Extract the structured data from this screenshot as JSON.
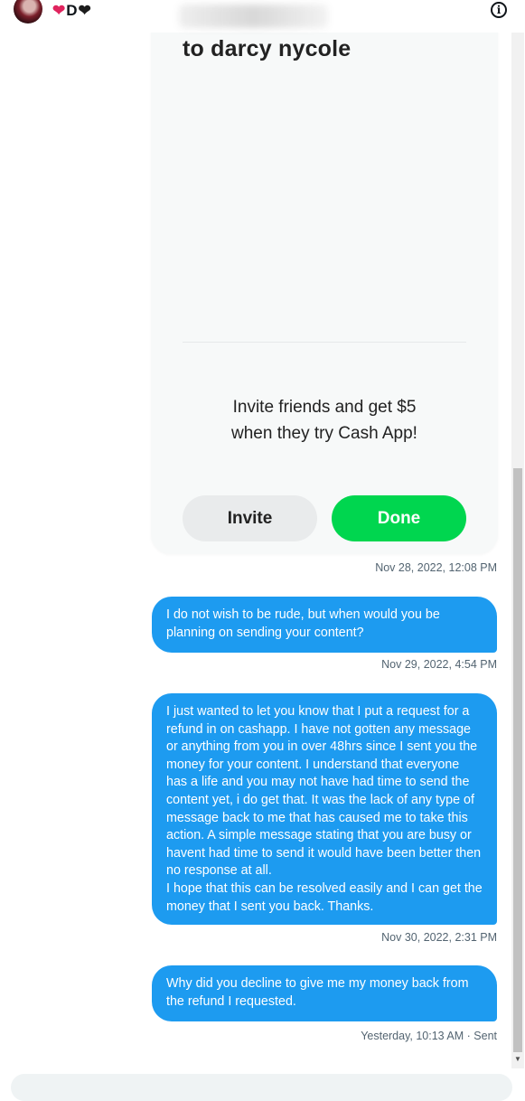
{
  "header": {
    "name_letter": "D",
    "info_icon": "info-circle-icon",
    "heart_icon_1": "sparkling-heart-icon",
    "heart_icon_2": "black-heart-icon"
  },
  "payment_card": {
    "recipient_line": "to darcy nycole",
    "invite_text_line1": "Invite friends and get $5",
    "invite_text_line2": "when they try Cash App!",
    "invite_button": "Invite",
    "done_button": "Done",
    "done_color": "#00d64f"
  },
  "messages": [
    {
      "timestamp": "Nov 28, 2022, 12:08 PM"
    },
    {
      "text": "I do not wish to be rude, but when would you be planning on sending your content?",
      "timestamp": "Nov 29, 2022, 4:54 PM"
    },
    {
      "text_lines": [
        "I just wanted to let you know that I put a request for a refund in on cashapp. I have not gotten any message or anything from you in over 48hrs since I sent you the money for your content. I understand that everyone has a life and you may not have had time to send the content yet, i do get that. It was the lack of any type of message back to me that has caused me to take this action. A simple message stating that you are busy or havent had time to send it would have been better then no response at all.",
        "I hope that this can be resolved easily and I can get the money that I sent you back. Thanks."
      ],
      "timestamp": "Nov 30, 2022, 2:31 PM"
    },
    {
      "text": "Why did you decline to give me my money back from the refund I requested.",
      "timestamp": "Yesterday, 10:13 AM · Sent"
    }
  ],
  "colors": {
    "bubble": "#1d9bf0",
    "timestamp": "#536471"
  }
}
